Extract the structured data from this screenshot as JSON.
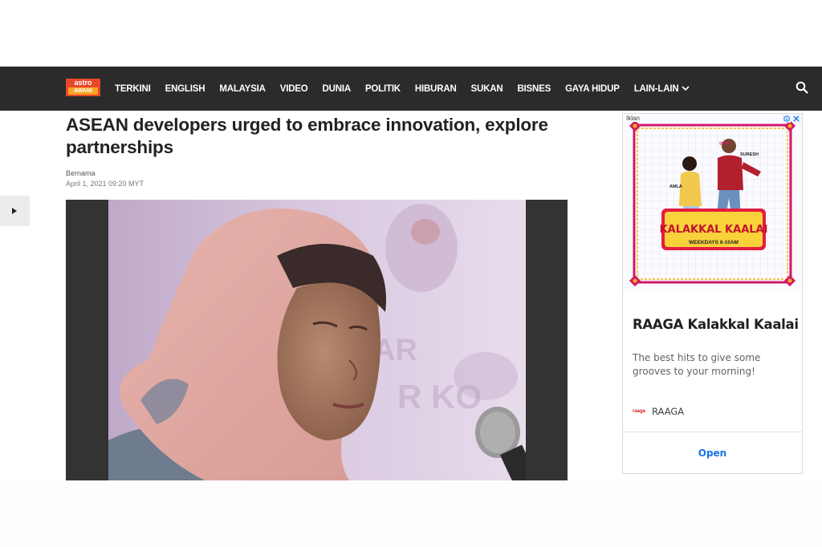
{
  "site": {
    "logo_top": "astro",
    "logo_bottom": "AWANI"
  },
  "nav": {
    "items": [
      {
        "label": "TERKINI"
      },
      {
        "label": "ENGLISH"
      },
      {
        "label": "MALAYSIA"
      },
      {
        "label": "VIDEO"
      },
      {
        "label": "DUNIA"
      },
      {
        "label": "POLITIK"
      },
      {
        "label": "HIBURAN"
      },
      {
        "label": "SUKAN"
      },
      {
        "label": "BISNES"
      },
      {
        "label": "GAYA HIDUP"
      }
    ],
    "more_label": "LAIN-LAIN",
    "search_icon": "search-icon"
  },
  "article": {
    "title": "ASEAN developers urged to embrace innovation, explore partnerships",
    "source": "Bernama",
    "date": "April 1, 2021 09:20 MYT"
  },
  "ad": {
    "label": "Iklan",
    "banner_text": "KALAKKAL KAALAI",
    "banner_subtext": "WEEKDAYS 6-10AM",
    "host_left": "AMLA",
    "host_right": "SURESH",
    "title": "RAAGA Kalakkal Kaalai",
    "description": "The best hits to give some grooves to your morning!",
    "brand_logo": "raaga",
    "brand": "RAAGA",
    "cta": "Open"
  },
  "colors": {
    "navbar": "#2b2b2b",
    "logo_red": "#e8472b",
    "link_blue": "#1a73e8"
  }
}
